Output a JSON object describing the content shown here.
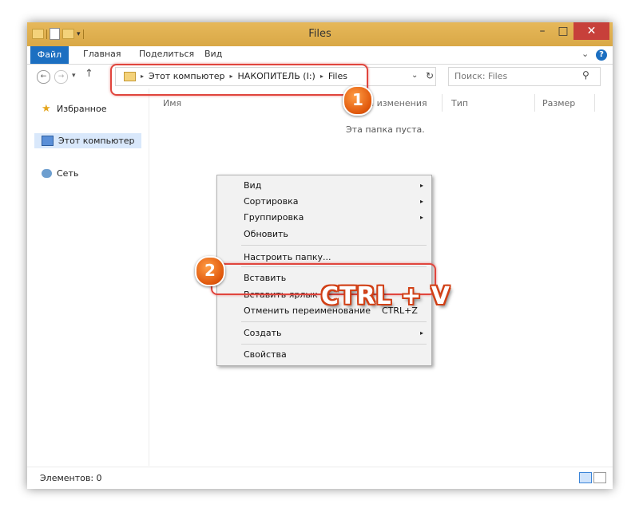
{
  "window": {
    "title": "Files",
    "controls": {
      "minimize": "–",
      "maximize": "□",
      "close": "✕"
    }
  },
  "ribbon": {
    "tabs": [
      "Файл",
      "Главная",
      "Поделиться",
      "Вид"
    ],
    "expand": "⌄",
    "help": "?"
  },
  "address": {
    "back": "←",
    "forward": "→",
    "recent": "▾",
    "up": "↑",
    "crumbs": [
      "Этот компьютер",
      "НАКОПИТЕЛЬ (I:)",
      "Files"
    ],
    "dropdown": "⌄",
    "refresh": "↻"
  },
  "search": {
    "placeholder": "Поиск: Files",
    "icon": "⚲"
  },
  "nav_pane": {
    "items": [
      {
        "label": "Избранное",
        "icon": "star-icon"
      },
      {
        "label": "Этот компьютер",
        "icon": "computer-icon",
        "selected": true
      },
      {
        "label": "Сеть",
        "icon": "network-icon"
      }
    ]
  },
  "columns": [
    "Имя",
    "та изменения",
    "Тип",
    "Размер"
  ],
  "empty_message": "Эта папка пуста.",
  "status": {
    "items_text": "Элементов: 0"
  },
  "context_menu": {
    "items": [
      {
        "label": "Вид",
        "submenu": true
      },
      {
        "label": "Сортировка",
        "submenu": true
      },
      {
        "label": "Группировка",
        "submenu": true
      },
      {
        "label": "Обновить"
      },
      {
        "label": "Настроить папку..."
      },
      {
        "label": "Вставить"
      },
      {
        "label": "Вставить ярлык"
      },
      {
        "label": "Отменить переименование",
        "shortcut": "CTRL+Z"
      },
      {
        "label": "Создать",
        "submenu": true
      },
      {
        "label": "Свойства"
      }
    ],
    "submenu_arrow": "▸"
  },
  "annotations": {
    "badge_1": "1",
    "badge_2": "2",
    "hotkey": "CTRL + V",
    "highlight_color": "#e0453d",
    "badge_color": "#f07a1d"
  },
  "colors": {
    "titlebar": "#dcae4c",
    "file_tab": "#1c6fc1",
    "close_button": "#c7403a",
    "selection": "#d9e8fb"
  }
}
